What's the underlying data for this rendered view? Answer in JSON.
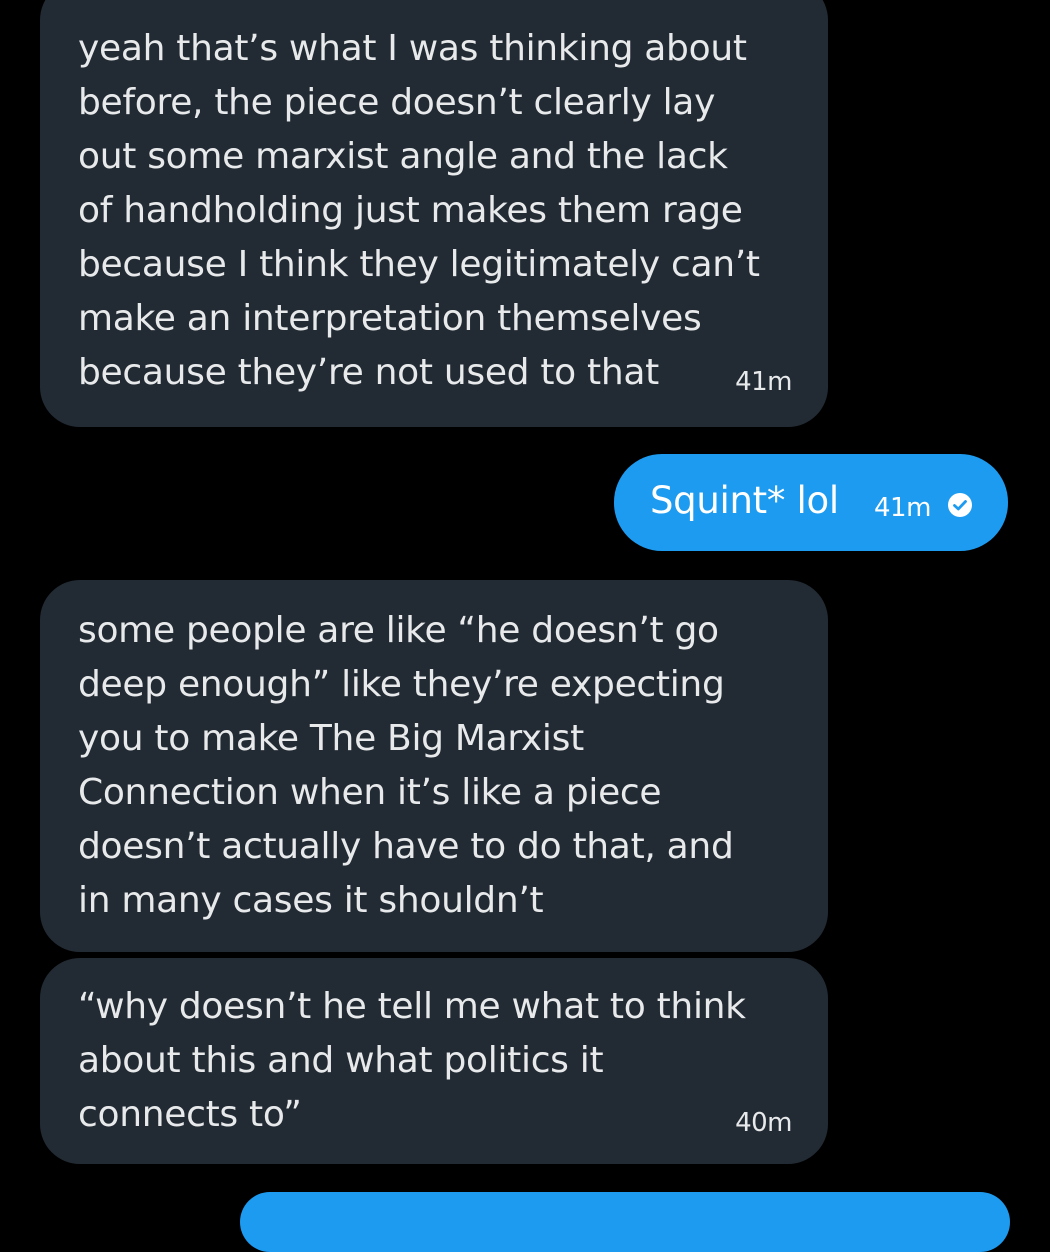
{
  "conversation": {
    "messages": [
      {
        "side": "received",
        "text": "yeah that’s what I was thinking about\nbefore, the piece doesn’t clearly lay\nout some marxist angle and the lack\nof handholding just makes them rage\nbecause I think they legitimately can’t\nmake an interpretation themselves\nbecause they’re not used to that",
        "time": "41m"
      },
      {
        "side": "sent",
        "text": "Squint* lol",
        "time": "41m",
        "status_icon": "check-circle-icon"
      },
      {
        "side": "received",
        "text": "some people are like “he doesn’t go\ndeep enough” like they’re expecting\nyou to make The Big Marxist\nConnection when it’s like a piece\ndoesn’t actually have to do that, and\nin many cases it shouldn’t",
        "time": ""
      },
      {
        "side": "received",
        "text": "“why doesn’t he tell me what to think\nabout this and what politics it\nconnects to”",
        "time": "40m"
      },
      {
        "side": "sent",
        "text": "",
        "time": ""
      }
    ]
  },
  "colors": {
    "background": "#000000",
    "received_bubble": "#222b34",
    "sent_bubble": "#1d9bf0",
    "text": "#e7e9ea"
  }
}
